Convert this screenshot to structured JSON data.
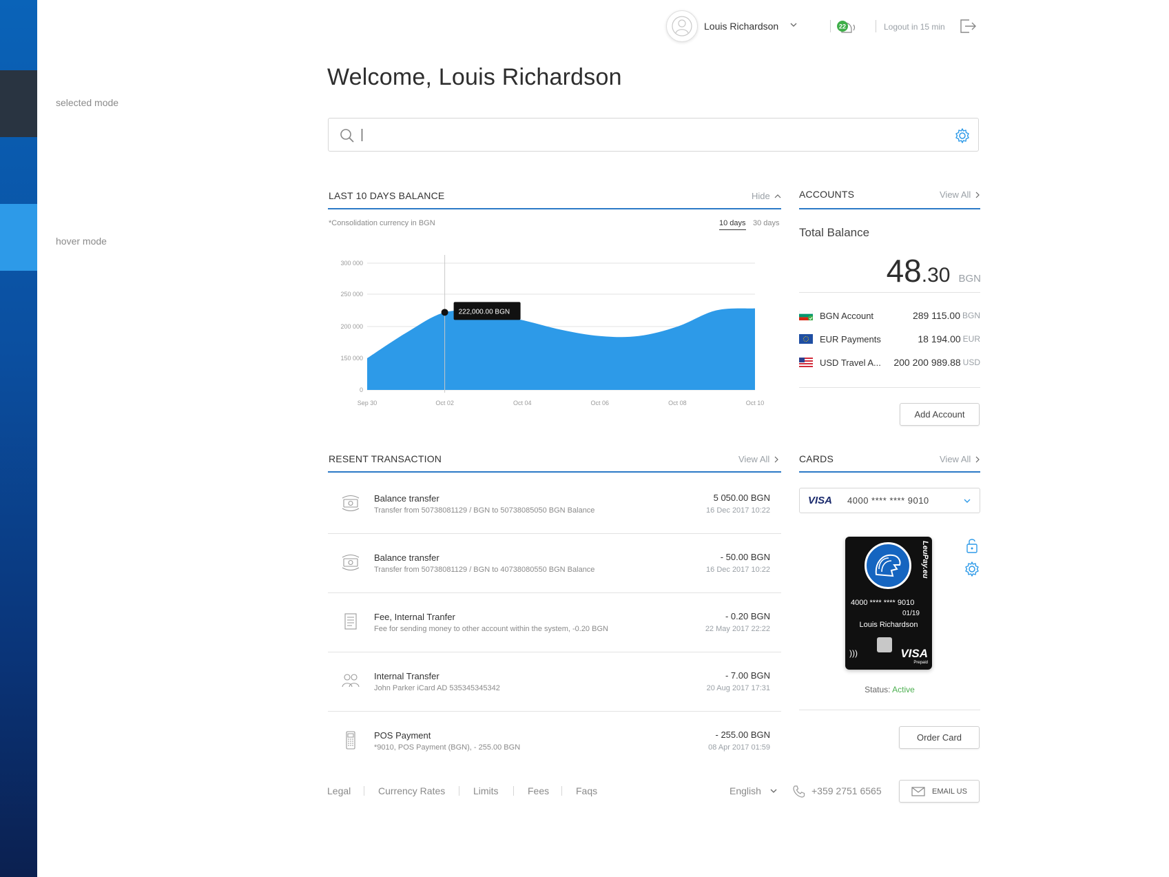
{
  "sidebar": {
    "selected_label": "selected mode",
    "hover_label": "hover mode"
  },
  "header": {
    "user_name": "Louis Richardson",
    "notification_count": "22",
    "logout_text": "Logout in 15 min"
  },
  "welcome": "Welcome, Louis Richardson",
  "search": {
    "value": "",
    "placeholder": ""
  },
  "balance": {
    "title": "LAST 10 DAYS BALANCE",
    "hide_label": "Hide",
    "note": "*Consolidation currency in BGN",
    "ranges": [
      "10 days",
      "30 days"
    ],
    "active_range": "10 days"
  },
  "chart_data": {
    "type": "area",
    "x": [
      "Sep 30",
      "Oct 01",
      "Oct 02",
      "Oct 03",
      "Oct 04",
      "Oct 05",
      "Oct 06",
      "Oct 07",
      "Oct 08",
      "Oct 09",
      "Oct 10"
    ],
    "values": [
      150000,
      190000,
      222000,
      222000,
      210000,
      195000,
      185000,
      185000,
      200000,
      225000,
      228000
    ],
    "x_tick_labels": [
      "Sep 30",
      "Oct 02",
      "Oct 04",
      "Oct 06",
      "Oct 08",
      "Oct 10"
    ],
    "y_tick_labels": [
      "0",
      "150 000",
      "200 000",
      "250 000",
      "300 000"
    ],
    "y_ticks": [
      0,
      150000,
      200000,
      250000,
      300000
    ],
    "tooltip": {
      "x": "Oct 02",
      "value": 222000,
      "label": "222,000.00",
      "currency": "BGN"
    },
    "color": "#2d9ae8",
    "grid": true
  },
  "accounts": {
    "title": "ACCOUNTS",
    "view_all": "View All",
    "total_label": "Total Balance",
    "total_int": "48",
    "total_dec": ".30",
    "total_currency": "BGN",
    "items": [
      {
        "name": "BGN Account",
        "amount": "289 115.00",
        "currency": "BGN",
        "flag": "bulgaria-flag-icon"
      },
      {
        "name": "EUR Payments",
        "amount": "18 194.00",
        "currency": "EUR",
        "flag": "eu-flag-icon"
      },
      {
        "name": "USD Travel A...",
        "amount": "200 200 989.88",
        "currency": "USD",
        "flag": "us-flag-icon"
      }
    ],
    "add_button": "Add Account"
  },
  "transactions": {
    "title": "RESENT TRANSACTION",
    "view_all": "View All",
    "items": [
      {
        "title": "Balance transfer",
        "desc": "Transfer from 50738081129 / BGN to 50738085050 BGN Balance",
        "amount": "5 050.00 BGN",
        "date": "16 Dec 2017   10:22",
        "icon": "money-transfer-icon"
      },
      {
        "title": "Balance transfer",
        "desc": "Transfer from 50738081129 / BGN to 40738080550 BGN Balance",
        "amount": "- 50.00 BGN",
        "date": "16 Dec 2017   10:22",
        "icon": "money-transfer-icon"
      },
      {
        "title": "Fee, Internal Tranfer",
        "desc": "Fee for sending money to other account within the system, -0.20 BGN",
        "amount": "- 0.20 BGN",
        "date": "22 May 2017   22:22",
        "icon": "document-icon"
      },
      {
        "title": "Internal Transfer",
        "desc": "John Parker  iCard AD 535345345342",
        "amount": "- 7.00 BGN",
        "date": "20 Aug 2017   17:31",
        "icon": "users-transfer-icon"
      },
      {
        "title": "POS Payment",
        "desc": "*9010, POS Payment (BGN), - 255.00 BGN",
        "amount": "- 255.00 BGN",
        "date": "08 Apr 2017   01:59",
        "icon": "pos-terminal-icon"
      }
    ]
  },
  "cards": {
    "title": "CARDS",
    "view_all": "View All",
    "selected_brand": "VISA",
    "selected_number": "4000  ****  ****  9010",
    "card": {
      "brand_vertical": "LeuPay.eu",
      "number": "4000 **** **** 9010",
      "expiry": "01/19",
      "holder": "Louis Richardson",
      "network": "VISA",
      "network_sub": "Prepaid"
    },
    "status_label": "Status:",
    "status_value": "Active",
    "order_button": "Order Card"
  },
  "footer": {
    "links": [
      "Legal",
      "Currency Rates",
      "Limits",
      "Fees",
      "Faqs"
    ],
    "language": "English",
    "phone": "+359 2751 6565",
    "email_button": "EMAIL US"
  },
  "colors": {
    "accent": "#2b79c6",
    "chart_fill": "#2d9ae8",
    "active_status": "#4caf50",
    "rail_selected": "#293441",
    "rail_hover": "#2d9ae8"
  }
}
